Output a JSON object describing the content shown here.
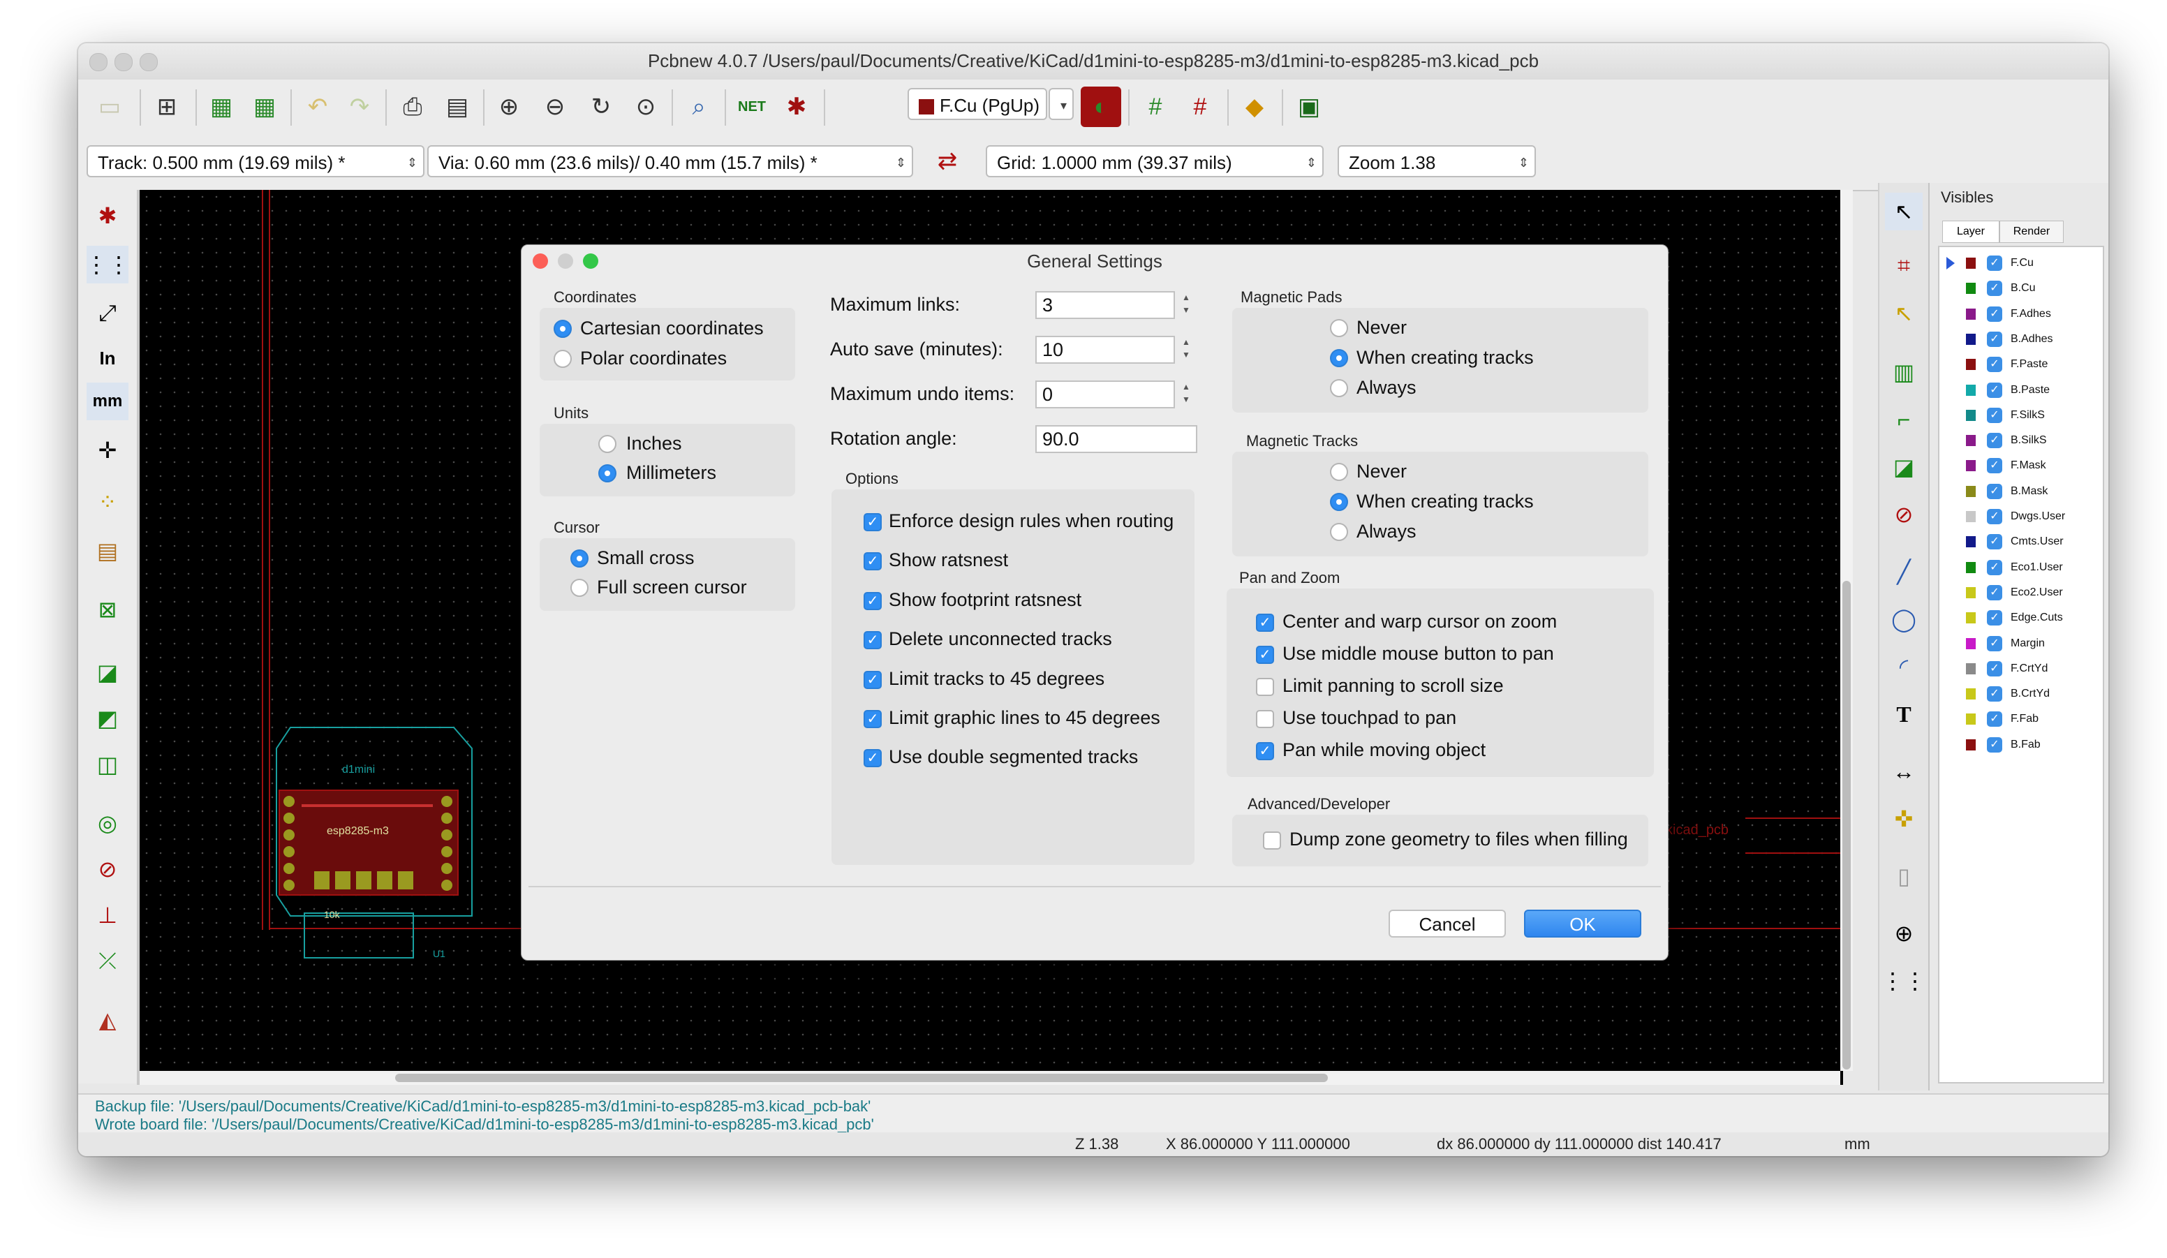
{
  "window": {
    "title": "Pcbnew 4.0.7 /Users/paul/Documents/Creative/KiCad/d1mini-to-esp8285-m3/d1mini-to-esp8285-m3.kicad_pcb"
  },
  "toolbar": {
    "icons": [
      "new-board",
      "page-settings",
      "load-netlist",
      "plot",
      "undo",
      "redo",
      "print",
      "plot-out",
      "zoom-in",
      "zoom-out",
      "redraw",
      "zoom-fit",
      "find",
      "netlist",
      "drc"
    ],
    "layer_select": "F.Cu (PgUp)"
  },
  "toolbar2": {
    "track": "Track: 0.500 mm (19.69 mils) *",
    "via": "Via: 0.60 mm (23.6 mils)/ 0.40 mm (15.7 mils) *",
    "grid": "Grid: 1.0000 mm (39.37 mils)",
    "zoom": "Zoom 1.38"
  },
  "left_tools": {
    "inch_label": "In",
    "mm_label": "mm"
  },
  "board": {
    "name_label": "d1mini",
    "part_label": "esp8285-m3",
    "resistor_label": "10k",
    "u_label": "U1",
    "file_label": "kicad_pcb"
  },
  "visibles": {
    "title": "Visibles",
    "tabs": [
      "Layer",
      "Render"
    ],
    "layers": [
      {
        "name": "F.Cu",
        "color": "#8b1010"
      },
      {
        "name": "B.Cu",
        "color": "#118a11"
      },
      {
        "name": "F.Adhes",
        "color": "#8a1a8a"
      },
      {
        "name": "B.Adhes",
        "color": "#121a8a"
      },
      {
        "name": "F.Paste",
        "color": "#8b1010"
      },
      {
        "name": "B.Paste",
        "color": "#13a9a9"
      },
      {
        "name": "F.SilkS",
        "color": "#138a8a"
      },
      {
        "name": "B.SilkS",
        "color": "#8a1a8a"
      },
      {
        "name": "F.Mask",
        "color": "#8a1a8a"
      },
      {
        "name": "B.Mask",
        "color": "#8a8a1a"
      },
      {
        "name": "Dwgs.User",
        "color": "#c8c8c8"
      },
      {
        "name": "Cmts.User",
        "color": "#121a8a"
      },
      {
        "name": "Eco1.User",
        "color": "#118a11"
      },
      {
        "name": "Eco2.User",
        "color": "#c8c81a"
      },
      {
        "name": "Edge.Cuts",
        "color": "#c8c81a"
      },
      {
        "name": "Margin",
        "color": "#c81ac8"
      },
      {
        "name": "F.CrtYd",
        "color": "#8a8a8a"
      },
      {
        "name": "B.CrtYd",
        "color": "#c8c81a"
      },
      {
        "name": "F.Fab",
        "color": "#c8c81a"
      },
      {
        "name": "B.Fab",
        "color": "#8b1010"
      }
    ]
  },
  "messages": [
    "Backup file: '/Users/paul/Documents/Creative/KiCad/d1mini-to-esp8285-m3/d1mini-to-esp8285-m3.kicad_pcb-bak'",
    "Wrote board file: '/Users/paul/Documents/Creative/KiCad/d1mini-to-esp8285-m3/d1mini-to-esp8285-m3.kicad_pcb'"
  ],
  "statusbar": {
    "zoom": "Z 1.38",
    "pos": "X 86.000000  Y 111.000000",
    "delta": "dx 86.000000  dy 111.000000  dist 140.417",
    "units": "mm"
  },
  "dialog": {
    "title": "General Settings",
    "coordinates": {
      "label": "Coordinates",
      "options": [
        "Cartesian coordinates",
        "Polar coordinates"
      ],
      "selected": 0
    },
    "units": {
      "label": "Units",
      "options": [
        "Inches",
        "Millimeters"
      ],
      "selected": 1
    },
    "cursor": {
      "label": "Cursor",
      "options": [
        "Small cross",
        "Full screen cursor"
      ],
      "selected": 0
    },
    "fields": [
      {
        "label": "Maximum links:",
        "value": "3"
      },
      {
        "label": "Auto save (minutes):",
        "value": "10"
      },
      {
        "label": "Maximum undo items:",
        "value": "0"
      },
      {
        "label": "Rotation angle:",
        "value": "90.0"
      }
    ],
    "options": {
      "label": "Options",
      "items": [
        {
          "label": "Enforce design rules when routing",
          "checked": true
        },
        {
          "label": "Show ratsnest",
          "checked": true
        },
        {
          "label": "Show footprint ratsnest",
          "checked": true
        },
        {
          "label": "Delete unconnected tracks",
          "checked": true
        },
        {
          "label": "Limit tracks to 45 degrees",
          "checked": true
        },
        {
          "label": "Limit graphic lines to 45 degrees",
          "checked": true
        },
        {
          "label": "Use double segmented tracks",
          "checked": true
        }
      ]
    },
    "magnetic_pads": {
      "label": "Magnetic Pads",
      "options": [
        "Never",
        "When creating tracks",
        "Always"
      ],
      "selected": 1
    },
    "magnetic_tracks": {
      "label": "Magnetic Tracks",
      "options": [
        "Never",
        "When creating tracks",
        "Always"
      ],
      "selected": 1
    },
    "pan_zoom": {
      "label": "Pan and Zoom",
      "items": [
        {
          "label": "Center and warp cursor on zoom",
          "checked": true
        },
        {
          "label": "Use middle mouse button to pan",
          "checked": true
        },
        {
          "label": "Limit panning to scroll size",
          "checked": false
        },
        {
          "label": "Use touchpad to pan",
          "checked": false
        },
        {
          "label": "Pan while moving object",
          "checked": true
        }
      ]
    },
    "advanced": {
      "label": "Advanced/Developer",
      "items": [
        {
          "label": "Dump zone geometry to files when filling",
          "checked": false
        }
      ]
    },
    "cancel_label": "Cancel",
    "ok_label": "OK"
  }
}
